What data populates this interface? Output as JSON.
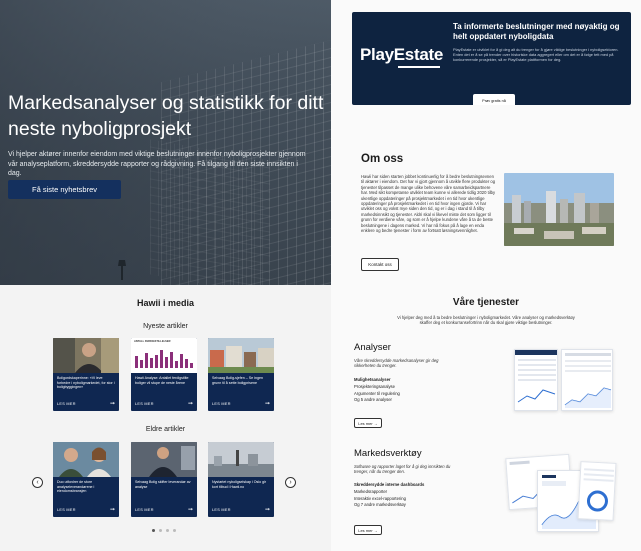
{
  "hero": {
    "title": "Markedsanalyser og statistikk for ditt neste nyboligprosjekt",
    "text": "Vi hjelper aktører innenfor eiendom med viktige beslutninger innenfor nyboligprosjekter gjennom vår analyseplatform, skreddersydde rapporter og rådgivning. Få tilgang til den siste innsikten i dag.",
    "button": "Få siste nyhetsbrev"
  },
  "media": {
    "title": "Hawii i media",
    "newest_label": "Nyeste artikler",
    "older_label": "Eldre artikler",
    "read_more": "LES MER",
    "newest": [
      {
        "text": "Boligordskaperinne: «Vi leve forbedre i nyboligmarkedet, for stor i boligbyggingen»"
      },
      {
        "text": "Hawii Analyse: Antallet ferdigstilte boliger vil stupe de neste årene"
      },
      {
        "text": "Selvaag Bolig-sjefen – Se ingen grunn til å sette boligprisene"
      }
    ],
    "older": [
      {
        "text": "Duo utfordrer de store analyseleverandørene i eiendomsbransjen"
      },
      {
        "text": "Selvaag Bolig skifter leverandør av analyse"
      },
      {
        "text": "Nystartet nyboligselskap i Oslo gir kort tilbud i Hawii.no"
      }
    ],
    "chart_card_label": "ANTALL FERDIGSTILLELSER"
  },
  "promo": {
    "logo": "PlayEstate",
    "title": "Ta informerte beslutninger med nøyaktig og helt oppdatert nyboligdata",
    "text": "PlayEstate er utviklet for å gi deg alt du trenger for å gjøre viktige beslutninger i nyboligsektoren. Enten det er å se på trender over historiske data aggregert eller om det er å følge tett med på konkurrerende prosjekter, så er PlayEstate plattformen for deg.",
    "button": "Prøv gratis nå"
  },
  "about": {
    "title": "Om oss",
    "text": "Hawii har siden starten jobbet kontinuerlig for å bedre beslutningsevnen til aktører i eiendom. Det har vi gjort gjennom å utvikle flere produkter og tjenester tilpasset de mange ulike behovene våre samarbeidspartnere har. Med sikt kompetanse utviklet team kunne vi allerede tidlig 2020 tilby ukentlige oppdateringer på prosjektmarkedet i en tid hvor ukentlige oppdateringer på prosjektmarkedet i en tid hvor ingen gjorde. Vi har utviklet oss og vokst mye siden den tid, og er i dag i stand til å tilby markedsinnsikt og tjenester. Aldri skal vi likevel miste det som ligger til grunn for verdiene våre, og som er å hjelpe kundene våre å ta de beste beslutningene i dagens marked. Vi har nå fokus på å lage en enda enklere og bedre tjenester i form av fortsatt løsningsvennlighet.",
    "button": "Kontakt oss"
  },
  "services": {
    "title": "Våre tjenester",
    "lead": "Vi hjelper deg med å ta bedre beslutninger i nyboligmarkedet. Våre analyser og markedsverktøy skaffer deg et konkurransefortrinn når du skal gjøre viktige beslutninger.",
    "analyses": {
      "title": "Analyser",
      "desc": "Våre skreddersydde markedsanalyser gir deg sikkerheten du trenger.",
      "items": [
        "Mulighetsanalyser",
        "Prosjekteringsanalyse",
        "Argumenter til regulering",
        "Og 5 andre analyser"
      ],
      "button": "Les mer →"
    },
    "tools": {
      "title": "Markedsverktøy",
      "desc": "Software og rapporter laget for å gi deg innsikten du trenger, når du trenger den.",
      "items": [
        "Skreddersydde interne dashboards",
        "Markedsrapporter",
        "Interaktiv excel-rapportering",
        "Og 7 andre markedsverktøy"
      ],
      "button": "Les mer →"
    }
  },
  "colors": {
    "navy": "#0f2751",
    "hero_button": "#14305e",
    "promo_bg": "#0e2340"
  }
}
